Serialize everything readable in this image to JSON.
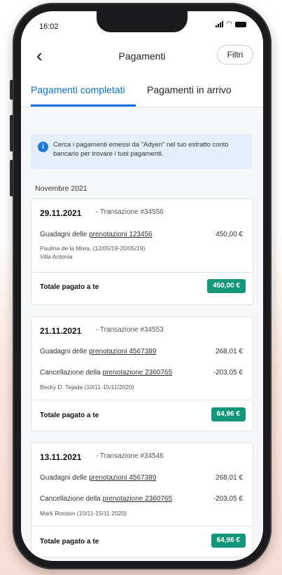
{
  "status_bar": {
    "time": "16:02"
  },
  "header": {
    "title": "Pagamenti",
    "filter_label": "Filtri",
    "back_glyph": "‹"
  },
  "tabs": [
    {
      "label": "Pagamenti completati",
      "active": true
    },
    {
      "label": "Pagamenti in arrivo",
      "active": false
    }
  ],
  "info_banner": {
    "icon": "info-icon",
    "text": "Cerca i pagamenti emessi da \"Adyen\" nel tuo estratto conto bancario per trovare i tuoi pagamenti."
  },
  "month_label": "Novembre 2021",
  "transactions": [
    {
      "date": "29.11.2021",
      "transaction": "- Transazione #34556",
      "lines": [
        {
          "prefix": "Guadagni delle ",
          "link": "prenotazioni 123456",
          "amount": "450,00 €"
        }
      ],
      "guest": "Paulina de la Mora, (12/05/19-20/05/19)",
      "property": "Villa Antonia",
      "total_label": "Totale pagato a te",
      "total": "450,00 €"
    },
    {
      "date": "21.11.2021",
      "transaction": "- Transazione #34553",
      "lines": [
        {
          "prefix": "Guadagni delle ",
          "link": "prenotazioni 4567389",
          "amount": "268,01 €"
        },
        {
          "prefix": "Cancellazione della ",
          "link": "prenotazione 2360765",
          "amount": "-203,05 €"
        }
      ],
      "guest": "Becky D. Tejada (10/11-15/11/2020)",
      "total_label": "Totale pagato a te",
      "total": "64,96 €"
    },
    {
      "date": "13.11.2021",
      "transaction": "- Transazione #34546",
      "lines": [
        {
          "prefix": "Guadagni delle ",
          "link": "prenotazioni 4567389",
          "amount": "268,01 €"
        },
        {
          "prefix": "Cancellazione della ",
          "link": "prenotazione 2360765",
          "amount": "-203,05 €"
        }
      ],
      "guest": "Mark Ronson (10/11-15/11 2020)",
      "total_label": "Totale pagato a te",
      "total": "64,96 €"
    }
  ],
  "colors": {
    "accent": "#0a6fd6",
    "total_badge": "#14967a",
    "info_bg": "#e3eef9"
  }
}
